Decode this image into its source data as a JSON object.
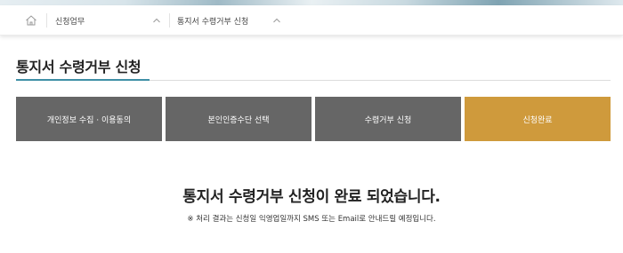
{
  "breadcrumb": {
    "home_icon": "home-icon",
    "level1_label": "신청업무",
    "level2_label": "통지서 수령거부 신청",
    "chevron_icon": "chevron-up-icon"
  },
  "page": {
    "title": "통지서 수령거부 신청"
  },
  "steps": {
    "step1_label": "개인정보 수집 · 이용동의",
    "step2_label": "본인인증수단 선택",
    "step3_label": "수령거부 신청",
    "step4_label": "신청완료",
    "active_step": 4
  },
  "result": {
    "message": "통지서 수령거부 신청이 완료 되었습니다.",
    "note": "※ 처리 결과는 신청일 익영업일까지 SMS 또는 Email로 안내드릴 예정입니다."
  },
  "colors": {
    "step_default": "#666666",
    "step_active": "#cf9a3c",
    "title_accent": "#3f8fa6"
  }
}
